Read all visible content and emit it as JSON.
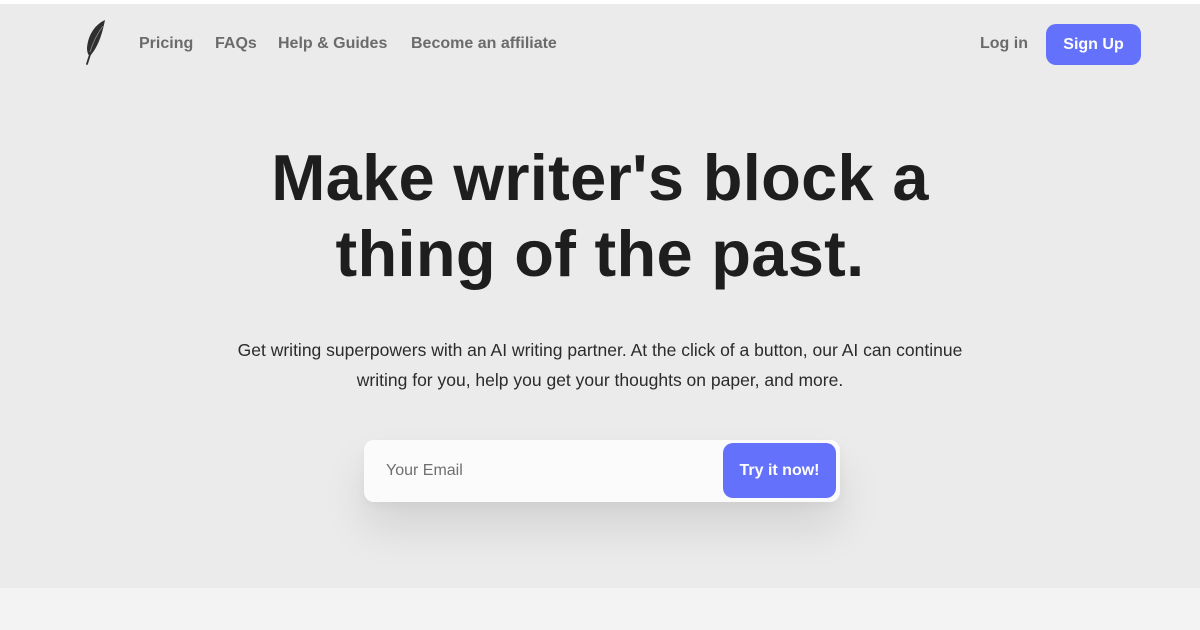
{
  "nav": {
    "links": [
      "Pricing",
      "FAQs",
      "Help & Guides",
      "Become an affiliate"
    ],
    "login": "Log in",
    "signup": "Sign Up"
  },
  "hero": {
    "headline_line1": "Make writer's block a",
    "headline_line2": "thing of the past.",
    "subtext_line1": "Get writing superpowers with an AI writing partner. At the click of a button, our AI can continue",
    "subtext_line2": "writing for you, help you get your thoughts on paper, and more."
  },
  "form": {
    "email_placeholder": "Your Email",
    "email_value": "",
    "submit_label": "Try it now!"
  },
  "icons": {
    "logo": "feather-icon"
  },
  "colors": {
    "accent": "#6472fb",
    "background": "#ebebeb",
    "bottom_band": "#f3f3f3",
    "headline": "#1e1e1e",
    "nav_text": "#6b6b6b"
  }
}
